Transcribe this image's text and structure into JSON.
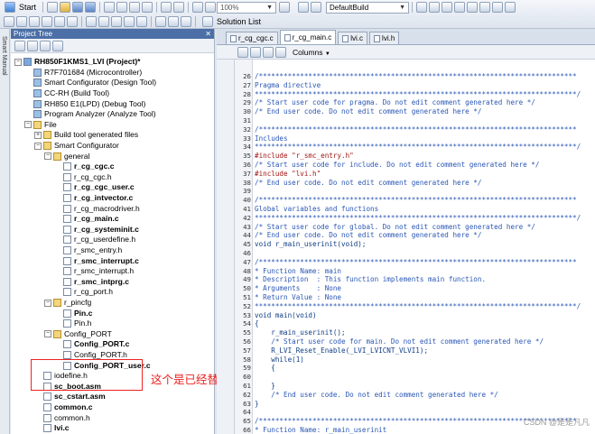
{
  "toolbar": {
    "start_label": "Start",
    "zoom_value": "100%",
    "build_mode_value": "DefaultBuild",
    "solution_list_label": "Solution List"
  },
  "left_strip": {
    "label": "Smart Manual"
  },
  "project_tree": {
    "title": "Project Tree",
    "pin": " &#x2715;",
    "rows": [
      {
        "label": "RH850F1KMS1_LVI (Project)*",
        "depth": 0,
        "exp": "-",
        "icon": "proj",
        "bold": true
      },
      {
        "label": "R7F701684 (Microcontroller)",
        "depth": 1,
        "exp": "",
        "icon": "tool",
        "bold": false
      },
      {
        "label": "Smart Configurator (Design Tool)",
        "depth": 1,
        "exp": "",
        "icon": "tool",
        "bold": false
      },
      {
        "label": "CC-RH (Build Tool)",
        "depth": 1,
        "exp": "",
        "icon": "tool",
        "bold": false
      },
      {
        "label": "RH850 E1(LPD) (Debug Tool)",
        "depth": 1,
        "exp": "",
        "icon": "tool",
        "bold": false
      },
      {
        "label": "Program Analyzer (Analyze Tool)",
        "depth": 1,
        "exp": "",
        "icon": "tool",
        "bold": false
      },
      {
        "label": "File",
        "depth": 1,
        "exp": "-",
        "icon": "folder",
        "bold": false
      },
      {
        "label": "Build tool generated files",
        "depth": 2,
        "exp": "+",
        "icon": "folder",
        "bold": false
      },
      {
        "label": "Smart Configurator",
        "depth": 2,
        "exp": "-",
        "icon": "folder",
        "bold": false
      },
      {
        "label": "general",
        "depth": 3,
        "exp": "-",
        "icon": "folder",
        "bold": false
      },
      {
        "label": "r_cg_cgc.c",
        "depth": 4,
        "exp": "",
        "icon": "file-c",
        "bold": true
      },
      {
        "label": "r_cg_cgc.h",
        "depth": 4,
        "exp": "",
        "icon": "file-h",
        "bold": false
      },
      {
        "label": "r_cg_cgc_user.c",
        "depth": 4,
        "exp": "",
        "icon": "file-c",
        "bold": true
      },
      {
        "label": "r_cg_intvector.c",
        "depth": 4,
        "exp": "",
        "icon": "file-c",
        "bold": true
      },
      {
        "label": "r_cg_macrodriver.h",
        "depth": 4,
        "exp": "",
        "icon": "file-h",
        "bold": false
      },
      {
        "label": "r_cg_main.c",
        "depth": 4,
        "exp": "",
        "icon": "file-c",
        "bold": true
      },
      {
        "label": "r_cg_systeminit.c",
        "depth": 4,
        "exp": "",
        "icon": "file-c",
        "bold": true
      },
      {
        "label": "r_cg_userdefine.h",
        "depth": 4,
        "exp": "",
        "icon": "file-h",
        "bold": false
      },
      {
        "label": "r_smc_entry.h",
        "depth": 4,
        "exp": "",
        "icon": "file-h",
        "bold": false
      },
      {
        "label": "r_smc_interrupt.c",
        "depth": 4,
        "exp": "",
        "icon": "file-c",
        "bold": true
      },
      {
        "label": "r_smc_interrupt.h",
        "depth": 4,
        "exp": "",
        "icon": "file-h",
        "bold": false
      },
      {
        "label": "r_smc_intprg.c",
        "depth": 4,
        "exp": "",
        "icon": "file-c",
        "bold": true
      },
      {
        "label": "r_cg_port.h",
        "depth": 4,
        "exp": "",
        "icon": "file-h",
        "bold": false
      },
      {
        "label": "r_pincfg",
        "depth": 3,
        "exp": "-",
        "icon": "folder",
        "bold": false
      },
      {
        "label": "Pin.c",
        "depth": 4,
        "exp": "",
        "icon": "file-c",
        "bold": true
      },
      {
        "label": "Pin.h",
        "depth": 4,
        "exp": "",
        "icon": "file-h",
        "bold": false
      },
      {
        "label": "Config_PORT",
        "depth": 3,
        "exp": "-",
        "icon": "folder",
        "bold": false
      },
      {
        "label": "Config_PORT.c",
        "depth": 4,
        "exp": "",
        "icon": "file-c",
        "bold": true
      },
      {
        "label": "Config_PORT.h",
        "depth": 4,
        "exp": "",
        "icon": "file-h",
        "bold": false
      },
      {
        "label": "Config_PORT_user.c",
        "depth": 4,
        "exp": "",
        "icon": "file-c",
        "bold": true
      },
      {
        "label": "iodefine.h",
        "depth": 2,
        "exp": "",
        "icon": "file-h",
        "bold": false
      },
      {
        "label": "sc_boot.asm",
        "depth": 2,
        "exp": "",
        "icon": "file-c",
        "bold": true
      },
      {
        "label": "sc_cstart.asm",
        "depth": 2,
        "exp": "",
        "icon": "file-c",
        "bold": true
      },
      {
        "label": "common.c",
        "depth": 2,
        "exp": "",
        "icon": "file-c",
        "bold": true
      },
      {
        "label": "common.h",
        "depth": 2,
        "exp": "",
        "icon": "file-h",
        "bold": false
      },
      {
        "label": "lvi.c",
        "depth": 2,
        "exp": "",
        "icon": "file-c",
        "bold": true
      },
      {
        "label": "lvi.h",
        "depth": 2,
        "exp": "",
        "icon": "file-h",
        "bold": false
      }
    ],
    "annotation": "这个是已经替换过的三个文件"
  },
  "editor": {
    "tabs": [
      {
        "label": "r_cg_cgc.c",
        "active": false
      },
      {
        "label": "r_cg_main.c",
        "active": true
      },
      {
        "label": "lvi.c",
        "active": false
      },
      {
        "label": "lvi.h",
        "active": false
      }
    ],
    "columns_label": "Columns",
    "lines": [
      {
        "n": "26",
        "t": "/*****************************************************************************",
        "c": "c-com"
      },
      {
        "n": "27",
        "t": "Pragma directive",
        "c": "c-com"
      },
      {
        "n": "28",
        "t": "******************************************************************************/",
        "c": "c-com"
      },
      {
        "n": "29",
        "t": "/* Start user code for pragma. Do not edit comment generated here */",
        "c": "c-com"
      },
      {
        "n": "30",
        "t": "/* End user code. Do not edit comment generated here */",
        "c": "c-com"
      },
      {
        "n": "31",
        "t": "",
        "c": "c-norm"
      },
      {
        "n": "32",
        "t": "/*****************************************************************************",
        "c": "c-com"
      },
      {
        "n": "33",
        "t": "Includes",
        "c": "c-com"
      },
      {
        "n": "34",
        "t": "******************************************************************************/",
        "c": "c-com"
      },
      {
        "n": "35",
        "t": "#include \"r_smc_entry.h\"",
        "c": "c-pre"
      },
      {
        "n": "36",
        "t": "/* Start user code for include. Do not edit comment generated here */",
        "c": "c-com"
      },
      {
        "n": "37",
        "t": "#include \"lvi.h\"",
        "c": "c-pre"
      },
      {
        "n": "38",
        "t": "/* End user code. Do not edit comment generated here */",
        "c": "c-com"
      },
      {
        "n": "39",
        "t": "",
        "c": "c-norm"
      },
      {
        "n": "40",
        "t": "/*****************************************************************************",
        "c": "c-com"
      },
      {
        "n": "41",
        "t": "Global variables and functions",
        "c": "c-com"
      },
      {
        "n": "42",
        "t": "******************************************************************************/",
        "c": "c-com"
      },
      {
        "n": "43",
        "t": "/* Start user code for global. Do not edit comment generated here */",
        "c": "c-com"
      },
      {
        "n": "44",
        "t": "/* End user code. Do not edit comment generated here */",
        "c": "c-com"
      },
      {
        "n": "45",
        "t": "void r_main_userinit(void);",
        "c": "c-dark"
      },
      {
        "n": "46",
        "t": "",
        "c": "c-norm"
      },
      {
        "n": "47",
        "t": "/*****************************************************************************",
        "c": "c-com"
      },
      {
        "n": "48",
        "t": "* Function Name: main",
        "c": "c-com"
      },
      {
        "n": "49",
        "t": "* Description  : This function implements main function.",
        "c": "c-com"
      },
      {
        "n": "50",
        "t": "* Arguments    : None",
        "c": "c-com"
      },
      {
        "n": "51",
        "t": "* Return Value : None",
        "c": "c-com"
      },
      {
        "n": "52",
        "t": "******************************************************************************/",
        "c": "c-com"
      },
      {
        "n": "53",
        "t": "void main(void)",
        "c": "c-dark"
      },
      {
        "n": "54",
        "t": "{",
        "c": "c-dark"
      },
      {
        "n": "55",
        "t": "    r_main_userinit();",
        "c": "c-dark"
      },
      {
        "n": "56",
        "t": "    /* Start user code for main. Do not edit comment generated here */",
        "c": "c-com"
      },
      {
        "n": "57",
        "t": "    R_LVI_Reset_Enable(_LVI_LVICNT_VLVI1);",
        "c": "c-dark"
      },
      {
        "n": "58",
        "t": "    while(1)",
        "c": "c-dark"
      },
      {
        "n": "59",
        "t": "    {",
        "c": "c-dark"
      },
      {
        "n": "60",
        "t": "",
        "c": "c-norm"
      },
      {
        "n": "61",
        "t": "    }",
        "c": "c-dark"
      },
      {
        "n": "62",
        "t": "    /* End user code. Do not edit comment generated here */",
        "c": "c-com"
      },
      {
        "n": "63",
        "t": "}",
        "c": "c-dark"
      },
      {
        "n": "64",
        "t": "",
        "c": "c-norm"
      },
      {
        "n": "65",
        "t": "/*****************************************************************************",
        "c": "c-com"
      },
      {
        "n": "66",
        "t": "* Function Name: r_main_userinit",
        "c": "c-com"
      }
    ]
  },
  "watermark": "CSDN @是是凡凡"
}
